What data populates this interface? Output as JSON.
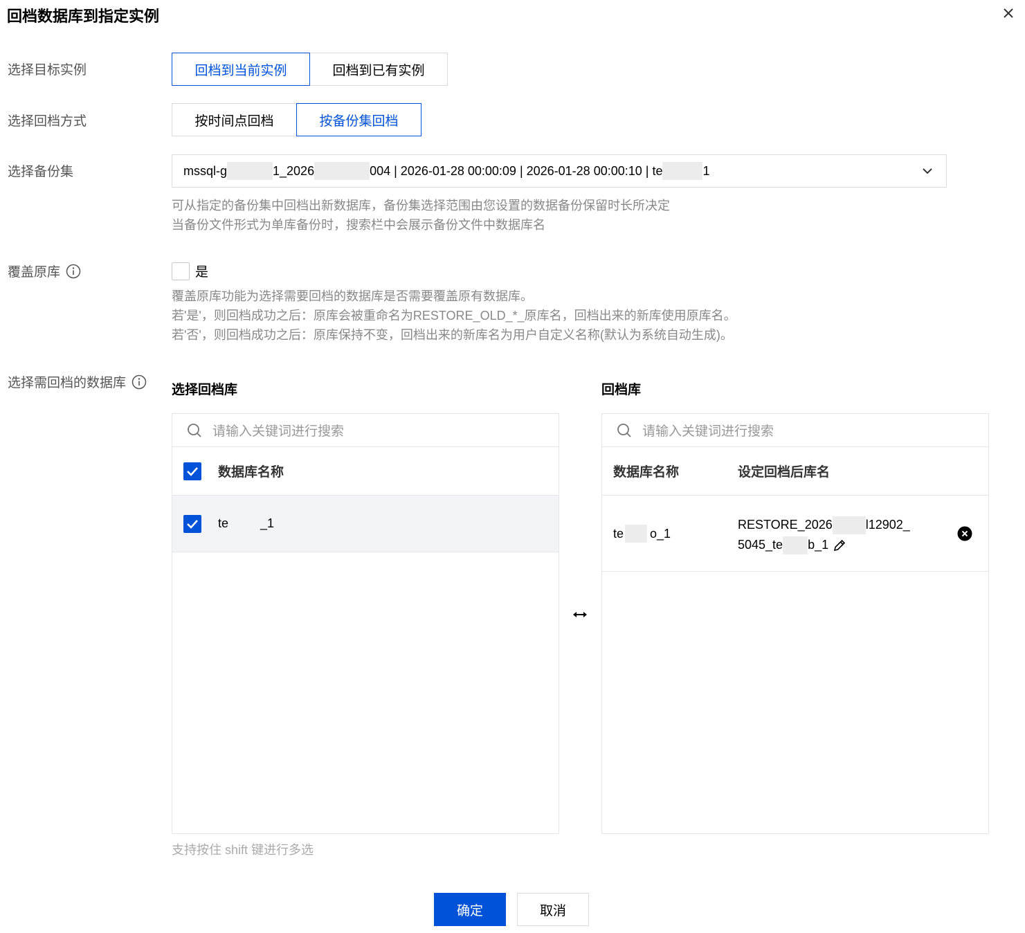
{
  "dialog": {
    "title": "回档数据库到指定实例"
  },
  "target_instance": {
    "label": "选择目标实例",
    "options": [
      "回档到当前实例",
      "回档到已有实例"
    ],
    "selected": "回档到当前实例"
  },
  "rollback_mode": {
    "label": "选择回档方式",
    "options": [
      "按时间点回档",
      "按备份集回档"
    ],
    "selected": "按备份集回档"
  },
  "backup_set": {
    "label": "选择备份集",
    "value_parts": [
      "mssql-g",
      "1_2026",
      "004 | 2026-01-28 00:00:09 | 2026-01-28 00:00:10 | te",
      "1"
    ],
    "help_lines": [
      "可从指定的备份集中回档出新数据库，备份集选择范围由您设置的数据备份保留时长所决定",
      "当备份文件形式为单库备份时，搜索栏中会展示备份文件中数据库名"
    ]
  },
  "overwrite": {
    "label": "覆盖原库",
    "checkbox_label": "是",
    "checked": false,
    "help_lines": [
      "覆盖原库功能为选择需要回档的数据库是否需要覆盖原有数据库。",
      "若'是'，则回档成功之后：原库会被重命名为RESTORE_OLD_*_原库名，回档出来的新库使用原库名。",
      "若'否'，则回档成功之后：原库保持不变，回档出来的新库名为用户自定义名称(默认为系统自动生成)。"
    ]
  },
  "databases": {
    "label": "选择需回档的数据库",
    "left_panel": {
      "title": "选择回档库",
      "search_placeholder": "请输入关键词进行搜索",
      "column_header": "数据库名称",
      "rows": [
        {
          "name_parts": [
            "te",
            "_1"
          ],
          "checked": true
        }
      ]
    },
    "right_panel": {
      "title": "回档库",
      "search_placeholder": "请输入关键词进行搜索",
      "column_headers": [
        "数据库名称",
        "设定回档后库名"
      ],
      "rows": [
        {
          "name_parts": [
            "te",
            "o_1"
          ],
          "restore_line1_parts": [
            "RESTORE_2026",
            "l12902_"
          ],
          "restore_line2_parts": [
            "5045_te",
            "b_1"
          ]
        }
      ]
    },
    "tip": "支持按住 shift 键进行多选"
  },
  "footer": {
    "confirm": "确定",
    "cancel": "取消"
  },
  "colors": {
    "primary": "#0052d9",
    "border": "#dcdcdc",
    "muted": "#888888"
  }
}
